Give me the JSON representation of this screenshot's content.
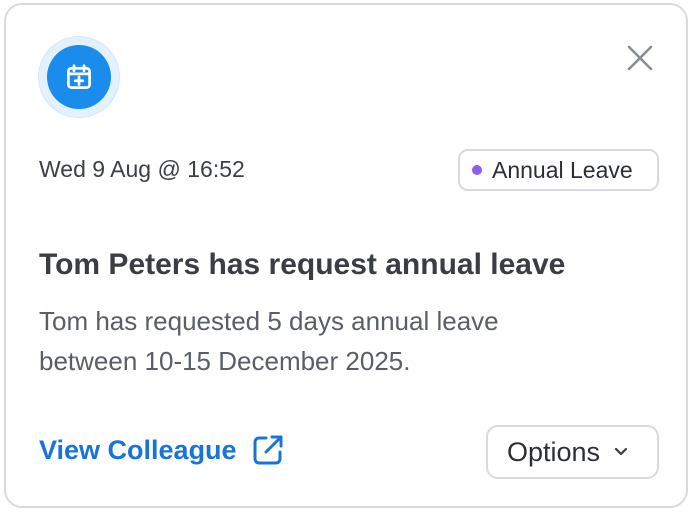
{
  "notification": {
    "icon": "calendar-plus-icon",
    "timestamp": "Wed 9 Aug @ 16:52",
    "badge": {
      "label": "Annual Leave",
      "dot_color": "#8b5cf6"
    },
    "title": "Tom Peters has request annual leave",
    "body": "Tom has requested 5 days annual leave between 10-15 December 2025.",
    "actions": {
      "view_label": "View Colleague",
      "options_label": "Options"
    },
    "colors": {
      "accent": "#1a8cec",
      "link": "#1774d8"
    }
  }
}
